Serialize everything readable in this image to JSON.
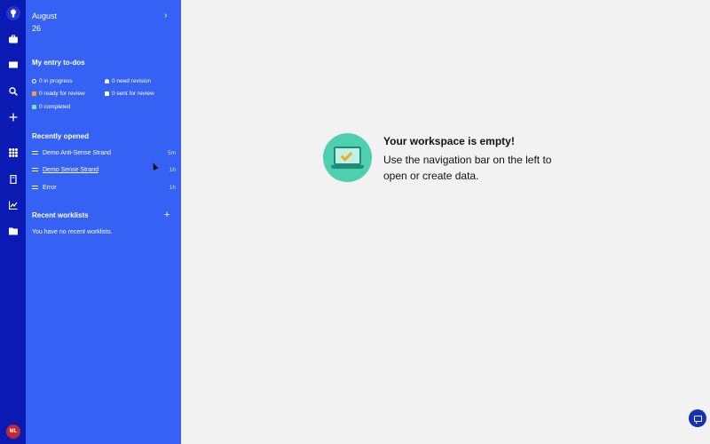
{
  "colors": {
    "rail": "#0a1bb3",
    "panel": "#3562f5",
    "accent_green": "#4ecfae",
    "avatar": "#c4272f",
    "fab": "#1630b8"
  },
  "rail": {
    "icons": [
      "logo-icon",
      "briefcase-icon",
      "book-icon",
      "search-icon",
      "plus-icon",
      "apps-grid-icon",
      "notebook-icon",
      "chart-icon",
      "folder-icon"
    ],
    "avatar_initials": "ML"
  },
  "panel": {
    "month": "August",
    "day": "26",
    "todos_title": "My entry to-dos",
    "todos": {
      "in_progress": "0 in progress",
      "need_revision": "0 need revision",
      "ready_for_review": "0 ready for review",
      "sent_for_review": "0 sent for review",
      "completed": "0 completed"
    },
    "recent_title": "Recently opened",
    "recent": [
      {
        "name": "Demo Anti-Sense Strand",
        "time": "5m"
      },
      {
        "name": "Demo Sense Strand",
        "time": "1h"
      },
      {
        "name": "Error",
        "time": "1h"
      }
    ],
    "worklists_title": "Recent worklists",
    "worklists_empty": "You have no recent worklists."
  },
  "main": {
    "empty_title": "Your workspace is empty!",
    "empty_subtitle": "Use the navigation bar on the left to open or create data."
  }
}
